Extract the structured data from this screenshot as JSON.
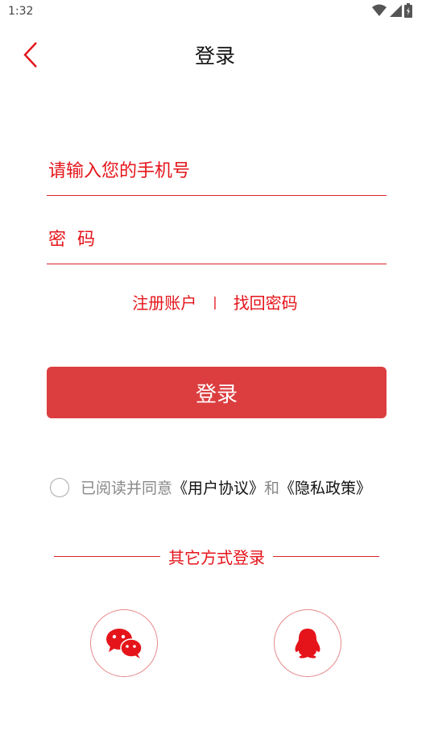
{
  "status_bar": {
    "time": "1:32",
    "icons": [
      "wifi-icon",
      "signal-icon",
      "battery-icon"
    ]
  },
  "header": {
    "title": "登录",
    "back_icon": "chevron-left-icon"
  },
  "form": {
    "phone_placeholder": "请输入您的手机号",
    "phone_value": "",
    "password_placeholder": "密  码",
    "password_value": ""
  },
  "links": {
    "register": "注册账户",
    "separator": "|",
    "forgot": "找回密码"
  },
  "login_button": "登录",
  "agreement": {
    "prefix": "已阅读并同意",
    "user_agreement": "《用户协议》",
    "and": "和",
    "privacy_policy": "《隐私政策》"
  },
  "other_login": {
    "label": "其它方式登录",
    "options": [
      {
        "icon": "wechat-icon"
      },
      {
        "icon": "qq-icon"
      }
    ]
  },
  "colors": {
    "accent": "#e5141a",
    "button": "#dc3e40",
    "line": "#d9252b"
  }
}
